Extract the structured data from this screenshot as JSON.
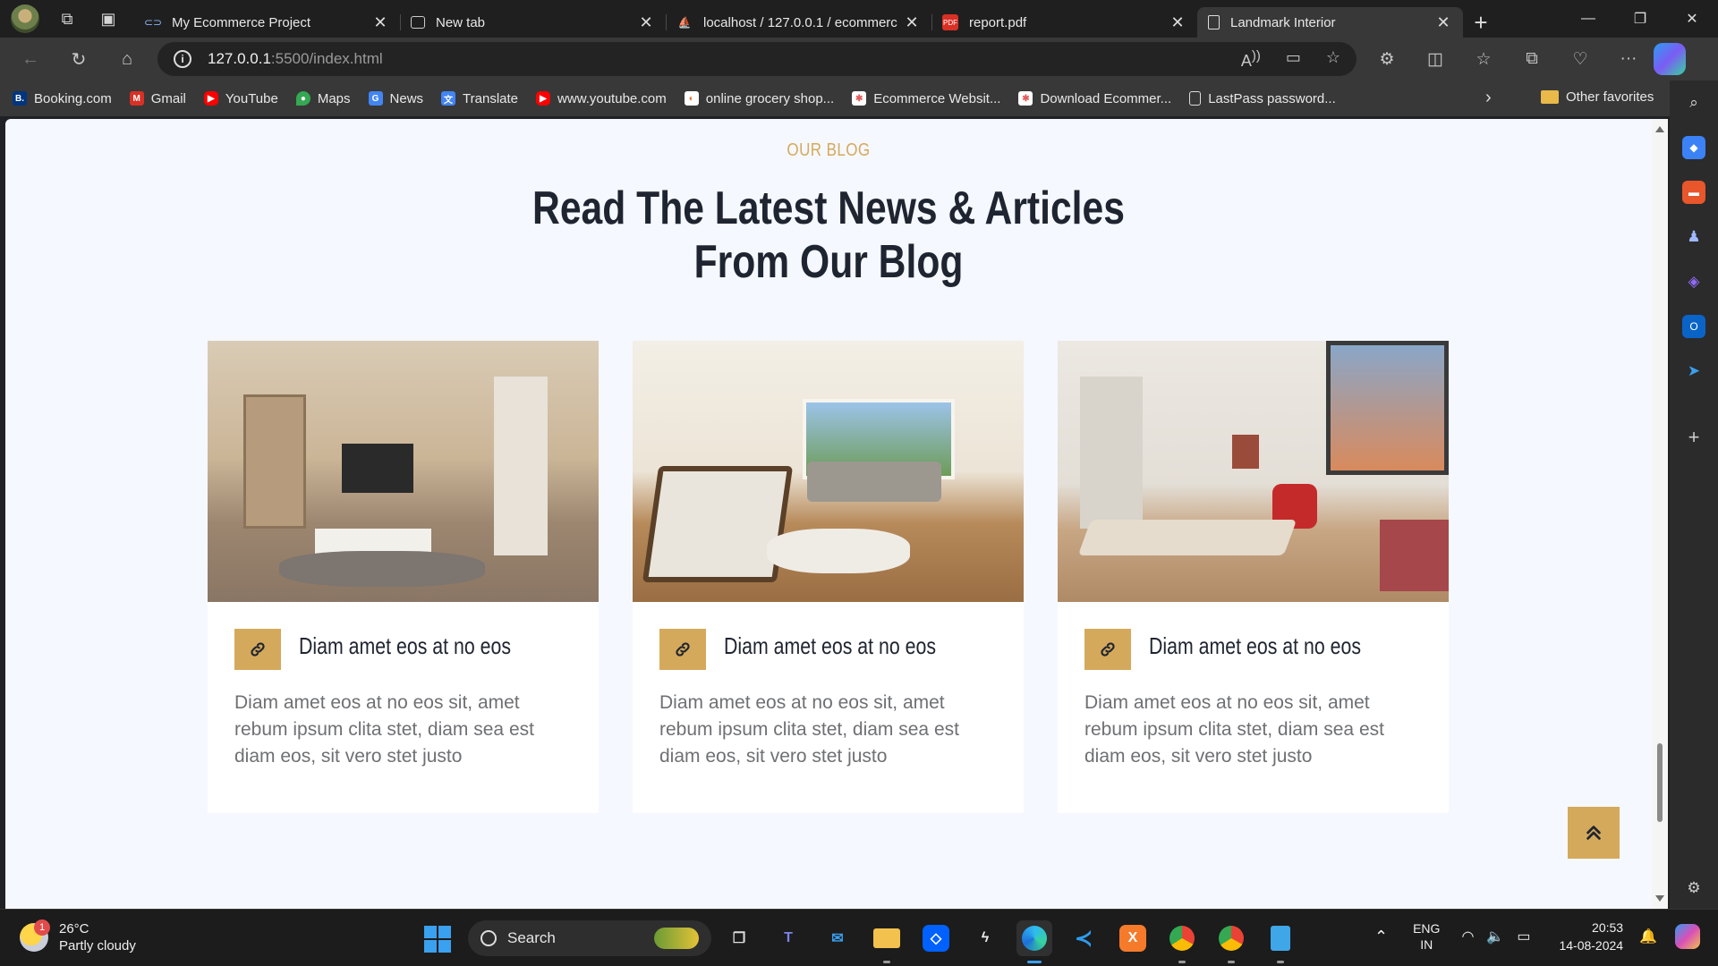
{
  "browser": {
    "tabs": [
      {
        "title": "My Ecommerce Project",
        "favicon": "link-icon",
        "active": false
      },
      {
        "title": "New tab",
        "favicon": "newtab-icon",
        "active": false
      },
      {
        "title": "localhost / 127.0.0.1 / ecommerc",
        "favicon": "phpmyadmin-icon",
        "active": false
      },
      {
        "title": "report.pdf",
        "favicon": "pdf-icon",
        "active": false
      },
      {
        "title": "Landmark Interior",
        "favicon": "page-icon",
        "active": true
      }
    ],
    "address": {
      "host": "127.0.0.1",
      "path": ":5500/index.html"
    },
    "favorites": [
      {
        "label": "Booking.com",
        "icon": "booking-icon",
        "color": "#003580",
        "glyph": "B."
      },
      {
        "label": "Gmail",
        "icon": "gmail-icon",
        "color": "#d93025",
        "glyph": "M"
      },
      {
        "label": "YouTube",
        "icon": "youtube-icon",
        "color": "#ff0000",
        "glyph": "▶"
      },
      {
        "label": "Maps",
        "icon": "maps-icon",
        "color": "#34a853",
        "glyph": "●"
      },
      {
        "label": "News",
        "icon": "news-icon",
        "color": "#4285f4",
        "glyph": "G"
      },
      {
        "label": "Translate",
        "icon": "translate-icon",
        "color": "#4285f4",
        "glyph": "文"
      },
      {
        "label": "www.youtube.com",
        "icon": "youtube-icon",
        "color": "#ff0000",
        "glyph": "▶"
      },
      {
        "label": "online grocery shop...",
        "icon": "grocery-icon",
        "color": "#e66b2f",
        "glyph": "◐"
      },
      {
        "label": "Ecommerce Websit...",
        "icon": "ecommerce-icon",
        "color": "#e35b5b",
        "glyph": "✱"
      },
      {
        "label": "Download Ecommer...",
        "icon": "ecommerce-icon",
        "color": "#e35b5b",
        "glyph": "✱"
      },
      {
        "label": "LastPass password...",
        "icon": "document-icon",
        "color": "#555555",
        "glyph": "▯"
      }
    ],
    "other_favorites": "Other favorites"
  },
  "page": {
    "subtitle": "OUR BLOG",
    "heading_line1": "Read The Latest News & Articles",
    "heading_line2": "From Our Blog",
    "accent": "#d5a95b",
    "cards": [
      {
        "title": "Diam amet eos at no eos",
        "body": "Diam amet eos at no eos sit, amet rebum ipsum clita stet, diam sea est diam eos, sit vero stet justo"
      },
      {
        "title": "Diam amet eos at no eos",
        "body": "Diam amet eos at no eos sit, amet rebum ipsum clita stet, diam sea est diam eos, sit vero stet justo"
      },
      {
        "title": "Diam amet eos at no eos",
        "body": "Diam amet eos at no eos sit, amet rebum ipsum clita stet, diam sea est diam eos, sit vero stet justo"
      }
    ]
  },
  "taskbar": {
    "weather_temp": "26°C",
    "weather_desc": "Partly cloudy",
    "weather_badge": "1",
    "search_label": "Search",
    "lang_top": "ENG",
    "lang_bottom": "IN",
    "time": "20:53",
    "date": "14-08-2024"
  }
}
